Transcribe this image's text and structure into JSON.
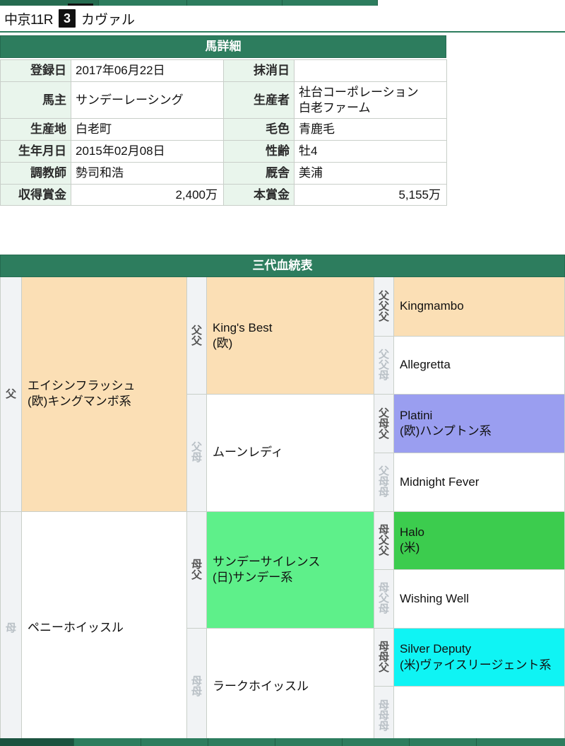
{
  "header": {
    "race": "中京11R",
    "number": "3",
    "horse_name": "カヴァル"
  },
  "detail": {
    "section_title": "馬詳細",
    "rows": [
      {
        "label_a": "登録日",
        "value_a": "2017年06月22日",
        "label_b": "抹消日",
        "value_b": ""
      },
      {
        "label_a": "馬主",
        "value_a": "サンデーレーシング",
        "label_b": "生産者",
        "value_b": "社台コーポレーション\n白老ファーム"
      },
      {
        "label_a": "生産地",
        "value_a": "白老町",
        "label_b": "毛色",
        "value_b": "青鹿毛"
      },
      {
        "label_a": "生年月日",
        "value_a": "2015年02月08日",
        "label_b": "性齢",
        "value_b": "牡4"
      },
      {
        "label_a": "調教師",
        "value_a": "勢司和浩",
        "label_b": "厩舎",
        "value_b": "美浦"
      },
      {
        "label_a": "収得賞金",
        "value_a": "2,400万",
        "label_b": "本賞金",
        "value_b": "5,155万"
      }
    ]
  },
  "pedigree": {
    "section_title": "三代血統表",
    "gen1": [
      {
        "label": "父",
        "name": "エイシンフラッシュ",
        "sub": "(欧)キングマンボ系",
        "color": "bg-peach",
        "dim": false
      },
      {
        "label": "母",
        "name": "ペニーホイッスル",
        "sub": "",
        "color": "bg-white",
        "dim": true
      }
    ],
    "gen2": [
      {
        "label": "父父",
        "name": "King's Best",
        "sub": "(欧)",
        "color": "bg-peach",
        "dim": false
      },
      {
        "label": "父母",
        "name": "ムーンレディ",
        "sub": "",
        "color": "bg-white",
        "dim": true
      },
      {
        "label": "母父",
        "name": "サンデーサイレンス",
        "sub": "(日)サンデー系",
        "color": "bg-green",
        "dim": false
      },
      {
        "label": "母母",
        "name": "ラークホイッスル",
        "sub": "",
        "color": "bg-white",
        "dim": true
      }
    ],
    "gen3": [
      {
        "label": "父父父",
        "name": "Kingmambo",
        "sub": "",
        "color": "bg-peach",
        "dim": false
      },
      {
        "label": "父父母",
        "name": "Allegretta",
        "sub": "",
        "color": "bg-white",
        "dim": true
      },
      {
        "label": "父母父",
        "name": "Platini",
        "sub": "(欧)ハンプトン系",
        "color": "bg-blue",
        "dim": false
      },
      {
        "label": "父母母",
        "name": "Midnight Fever",
        "sub": "",
        "color": "bg-white",
        "dim": true
      },
      {
        "label": "母父父",
        "name": "Halo",
        "sub": "(米)",
        "color": "bg-green2",
        "dim": false
      },
      {
        "label": "母父母",
        "name": "Wishing Well",
        "sub": "",
        "color": "bg-white",
        "dim": true
      },
      {
        "label": "母母父",
        "name": "Silver Deputy",
        "sub": "(米)ヴァイスリージェント系",
        "color": "bg-cyan",
        "dim": false
      },
      {
        "label": "母母母",
        "name": "",
        "sub": "",
        "color": "bg-white",
        "dim": true
      }
    ]
  },
  "colors": {
    "brand_green": "#2d7d5e",
    "label_mint": "#e9f5ec",
    "peach": "#fbdfb5",
    "blue": "#9a9ef0",
    "green": "#5ef08a",
    "green_dark": "#3ccc4e",
    "cyan": "#0ff4f4"
  }
}
